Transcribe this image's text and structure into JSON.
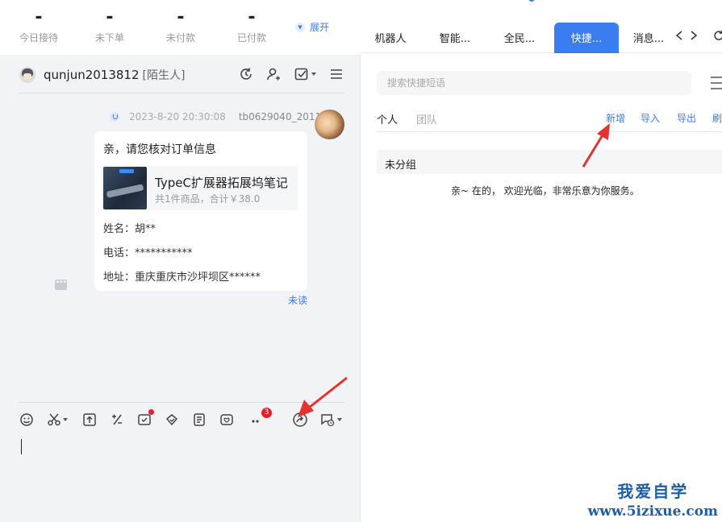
{
  "stats": [
    {
      "value": "-",
      "label": "今日接待"
    },
    {
      "value": "-",
      "label": "未下单"
    },
    {
      "value": "-",
      "label": "未付款"
    },
    {
      "value": "-",
      "label": "已付款"
    }
  ],
  "stats_expand": "展开",
  "chat": {
    "username": "qunjun2013812",
    "user_tag": "[陌生人]",
    "message": {
      "time": "2023-8-20 20:30:08",
      "sender": "tb0629040_2011",
      "title": "亲，请您核对订单信息",
      "product_name": "TypeC扩展器拓展坞笔记",
      "product_summary": "共1件商品，合计￥38.0",
      "name_line": "姓名：胡**",
      "phone_line": "电话：***********",
      "address_line": "地址：重庆重庆市沙坪坝区******",
      "status": "未读"
    }
  },
  "toolbar": {
    "badge_count": "3"
  },
  "right": {
    "tabs": [
      {
        "label": "机器人"
      },
      {
        "label": "智能..."
      },
      {
        "label": "全民..."
      },
      {
        "label": "快捷..."
      },
      {
        "label": "消息..."
      }
    ],
    "search_placeholder": "搜索快捷短语",
    "subtabs": [
      "个人",
      "团队"
    ],
    "actions": [
      "新增",
      "导入",
      "导出",
      "刷"
    ],
    "group_name": "未分组",
    "phrase": "亲~ 在的， 欢迎光临，非常乐意为你服务。"
  },
  "watermark": {
    "cn": "我爱自学",
    "url": "www.5izixue.com"
  },
  "colors": {
    "accent": "#3b7cf0",
    "badge_red": "#e5212b",
    "arrow_red": "#e8312f"
  }
}
